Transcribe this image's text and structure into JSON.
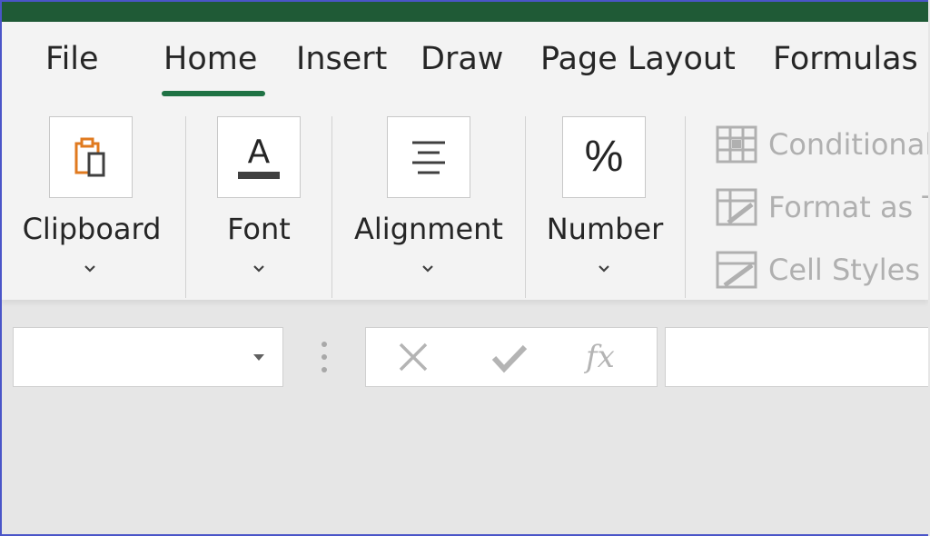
{
  "colors": {
    "title_bar": "#1f5a36",
    "accent": "#1f7244",
    "ribbon_bg": "#f3f3f3",
    "workspace_bg": "#e6e6e6",
    "clipboard_icon_orange": "#e07a1f",
    "disabled_text": "#b0b0b0",
    "frame_border": "#4a55c8"
  },
  "tabs": [
    {
      "label": "File"
    },
    {
      "label": "Home",
      "active": true
    },
    {
      "label": "Insert"
    },
    {
      "label": "Draw"
    },
    {
      "label": "Page Layout"
    },
    {
      "label": "Formulas"
    }
  ],
  "groups": {
    "clipboard": {
      "label": "Clipboard",
      "icon": "clipboard-icon"
    },
    "font": {
      "label": "Font",
      "icon": "font-color-icon",
      "glyph": "A"
    },
    "alignment": {
      "label": "Alignment",
      "icon": "align-center-icon"
    },
    "number": {
      "label": "Number",
      "icon": "percent-icon",
      "glyph": "%"
    }
  },
  "styles": {
    "conditional": {
      "label": "Conditional",
      "icon": "conditional-formatting-icon"
    },
    "format_as_table": {
      "label": "Format as T",
      "icon": "format-as-table-icon"
    },
    "cell_styles": {
      "label": "Cell Styles",
      "icon": "cell-styles-icon"
    }
  },
  "formula_bar": {
    "name_box_value": "",
    "fx_label": "fx",
    "formula_value": ""
  }
}
